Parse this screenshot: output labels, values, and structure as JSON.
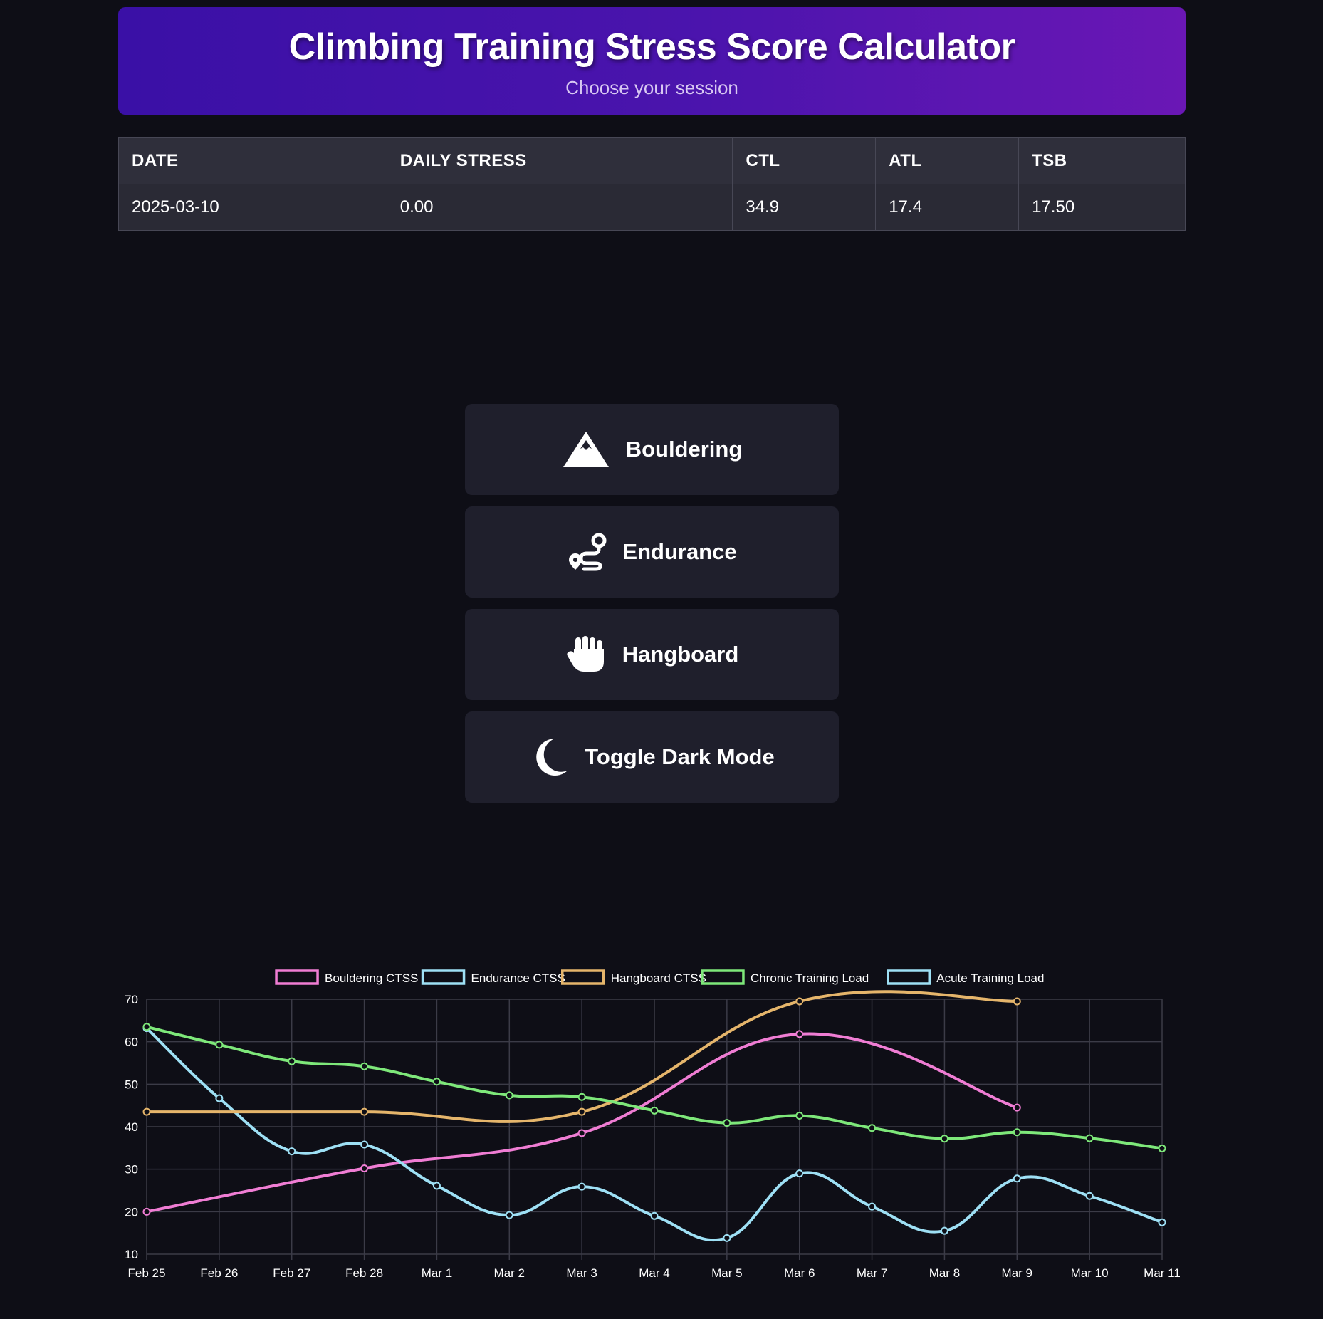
{
  "header": {
    "title": "Climbing Training Stress Score Calculator",
    "subtitle": "Choose your session"
  },
  "stats_table": {
    "headers": [
      "DATE",
      "DAILY STRESS",
      "CTL",
      "ATL",
      "TSB"
    ],
    "row": [
      "2025-03-10",
      "0.00",
      "34.9",
      "17.4",
      "17.50"
    ]
  },
  "buttons": {
    "bouldering": "Bouldering",
    "endurance": "Endurance",
    "hangboard": "Hangboard",
    "dark_mode": "Toggle Dark Mode"
  },
  "icons": {
    "bouldering": "mountain-icon",
    "endurance": "route-icon",
    "hangboard": "hand-icon",
    "dark_mode": "moon-icon"
  },
  "chart_data": {
    "type": "line",
    "x": [
      "Feb 25",
      "Feb 26",
      "Feb 27",
      "Feb 28",
      "Mar 1",
      "Mar 2",
      "Mar 3",
      "Mar 4",
      "Mar 5",
      "Mar 6",
      "Mar 7",
      "Mar 8",
      "Mar 9",
      "Mar 10",
      "Mar 11"
    ],
    "ylim": [
      10,
      70
    ],
    "yticks": [
      10,
      20,
      30,
      40,
      50,
      60,
      70
    ],
    "grid": true,
    "legend_position": "top",
    "series": [
      {
        "name": "Bouldering CTSS",
        "color": "#f07dd4",
        "points": [
          [
            0,
            20
          ],
          [
            3,
            30.2
          ],
          [
            6,
            38.5
          ],
          [
            9,
            61.8
          ],
          [
            12,
            44.5
          ]
        ]
      },
      {
        "name": "Endurance CTSS",
        "color": "#9ee0f5",
        "points": [
          [
            0,
            63.2
          ],
          [
            1,
            46.7
          ],
          [
            2,
            34.2
          ],
          [
            3,
            35.8
          ],
          [
            4,
            26.1
          ],
          [
            5,
            19.2
          ],
          [
            6,
            25.9
          ],
          [
            7,
            19.0
          ],
          [
            8,
            13.8
          ],
          [
            9,
            29.0
          ],
          [
            10,
            21.2
          ],
          [
            11,
            15.5
          ],
          [
            12,
            27.8
          ],
          [
            13,
            23.7
          ],
          [
            14,
            17.5
          ]
        ]
      },
      {
        "name": "Hangboard CTSS",
        "color": "#e5b56b",
        "points": [
          [
            0,
            43.5
          ],
          [
            3,
            43.5
          ],
          [
            6,
            43.5
          ],
          [
            9,
            69.5
          ],
          [
            12,
            69.5
          ]
        ]
      },
      {
        "name": "Chronic Training Load",
        "color": "#7ee87a",
        "points": [
          [
            0,
            63.5
          ],
          [
            1,
            59.3
          ],
          [
            2,
            55.4
          ],
          [
            3,
            54.2
          ],
          [
            4,
            50.6
          ],
          [
            5,
            47.4
          ],
          [
            6,
            47.0
          ],
          [
            7,
            43.8
          ],
          [
            8,
            40.9
          ],
          [
            9,
            42.6
          ],
          [
            10,
            39.7
          ],
          [
            11,
            37.2
          ],
          [
            12,
            38.7
          ],
          [
            13,
            37.3
          ],
          [
            14,
            34.9
          ]
        ]
      },
      {
        "name": "Acute Training Load",
        "color": "#9ee0f5",
        "points": []
      }
    ]
  }
}
